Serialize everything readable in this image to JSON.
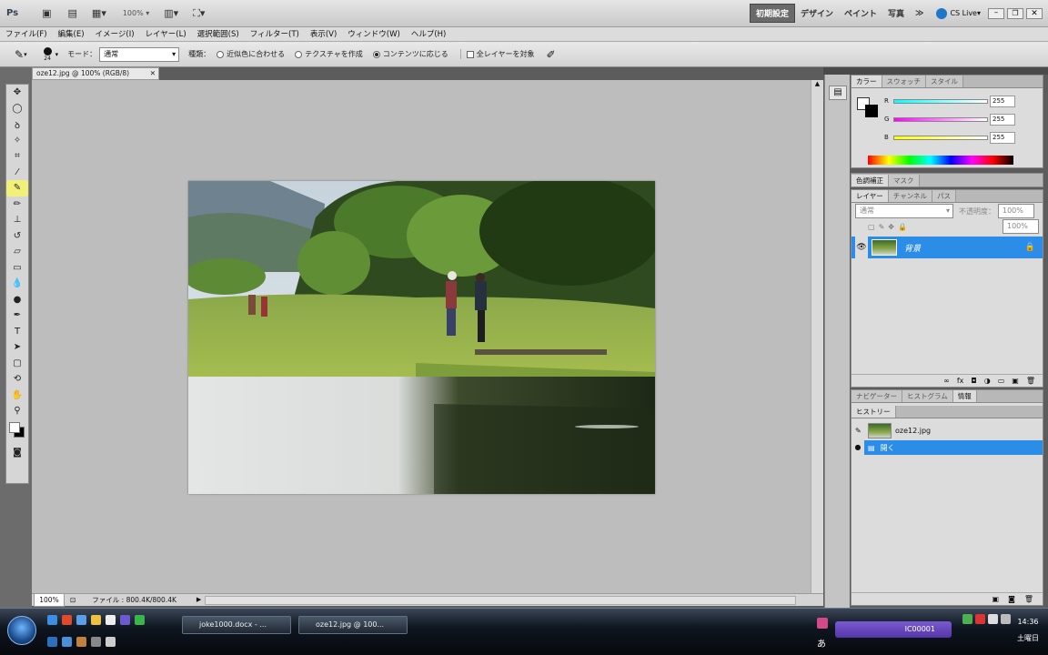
{
  "appbar": {
    "logo": "Ps",
    "zoom": "100%",
    "workspaces": [
      "初期設定",
      "デザイン",
      "ペイント",
      "写真"
    ],
    "more": "≫",
    "cslive": "CS Live"
  },
  "menu": [
    "ファイル(F)",
    "編集(E)",
    "イメージ(I)",
    "レイヤー(L)",
    "選択範囲(S)",
    "フィルター(T)",
    "表示(V)",
    "ウィンドウ(W)",
    "ヘルプ(H)"
  ],
  "options": {
    "brush_size": "24",
    "mode_label": "モード：",
    "mode_value": "通常",
    "type_label": "種類：",
    "radio_1": "近似色に合わせる",
    "radio_2": "テクスチャを作成",
    "radio_3": "コンテンツに応じる",
    "checkbox": "全レイヤーを対象"
  },
  "document": {
    "tab_title": "oze12.jpg @ 100% (RGB/8)",
    "zoom": "100%",
    "file_info": "ファイル : 800.4K/800.4K"
  },
  "color_panel": {
    "tabs": [
      "カラー",
      "スウォッチ",
      "スタイル"
    ],
    "r_label": "R",
    "g_label": "G",
    "b_label": "B",
    "r": "255",
    "g": "255",
    "b": "255"
  },
  "adjust_panel": {
    "tabs": [
      "色調補正",
      "マスク"
    ]
  },
  "layers_panel": {
    "tabs": [
      "レイヤー",
      "チャンネル",
      "パス"
    ],
    "blend": "通常",
    "opacity_label": "不透明度：",
    "opacity": "100%",
    "fill": "100%",
    "layer_name": "背景"
  },
  "history_panel": {
    "top_tabs": [
      "ナビゲーター",
      "ヒストグラム",
      "情報"
    ],
    "tab": "ヒストリー",
    "snapshot": "oze12.jpg",
    "step": "開く"
  },
  "taskbar": {
    "btn1": "joke1000.docx - ...",
    "btn2": "oze12.jpg @ 100...",
    "ime_text": "IC00001",
    "lang": "あ",
    "time": "14:36",
    "day": "土曜日"
  },
  "colors": {
    "selection_blue": "#2b8de8",
    "canvas_gray": "#bdbdbd",
    "toolbar_highlight": "#f3f07a"
  }
}
